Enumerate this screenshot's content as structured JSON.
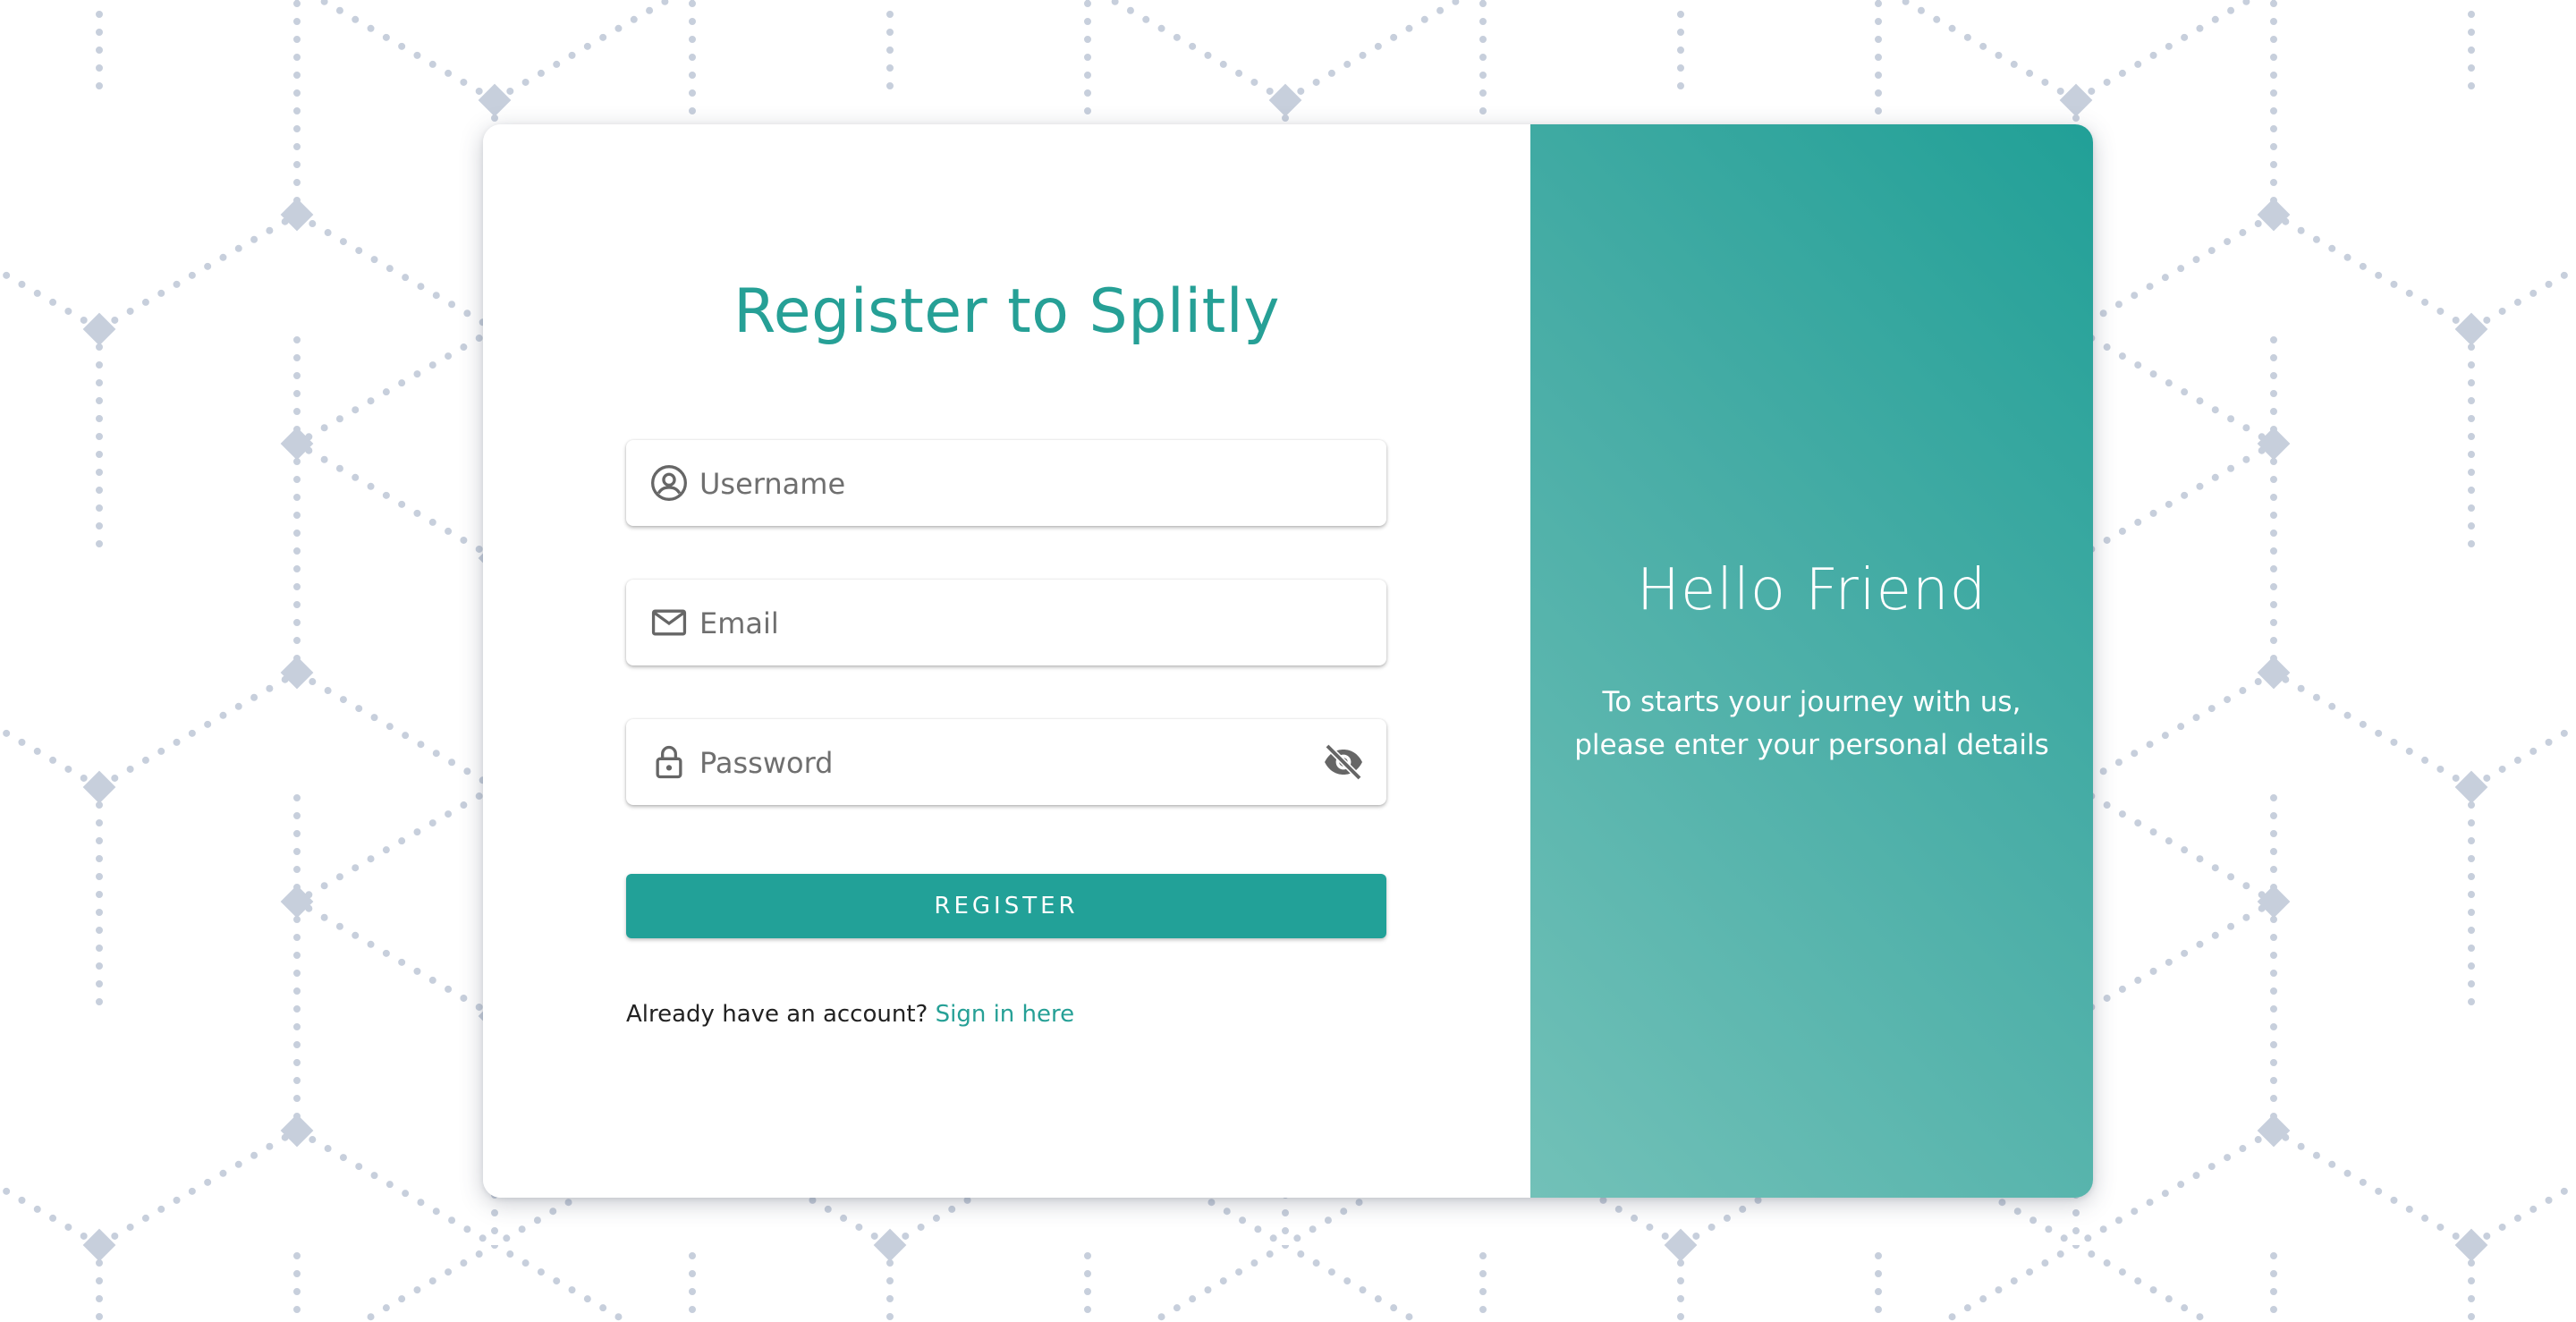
{
  "background": {
    "pattern_color": "#c7cfdc"
  },
  "form": {
    "title": "Register to Splitly",
    "username": {
      "placeholder": "Username",
      "icon": "account-circle-icon"
    },
    "email": {
      "placeholder": "Email",
      "icon": "mail-icon"
    },
    "password": {
      "placeholder": "Password",
      "icon": "lock-icon",
      "toggle_icon": "eye-off-icon"
    },
    "register_label": "REGISTER",
    "signin_prompt": "Already have an account?",
    "signin_link": "Sign in here"
  },
  "welcome": {
    "heading": "Hello Friend",
    "line1": "To starts your journey with us,",
    "line2": "please enter your personal details"
  },
  "colors": {
    "accent": "#26a096",
    "panel_start": "#21a097",
    "panel_end": "#72c1b8"
  }
}
